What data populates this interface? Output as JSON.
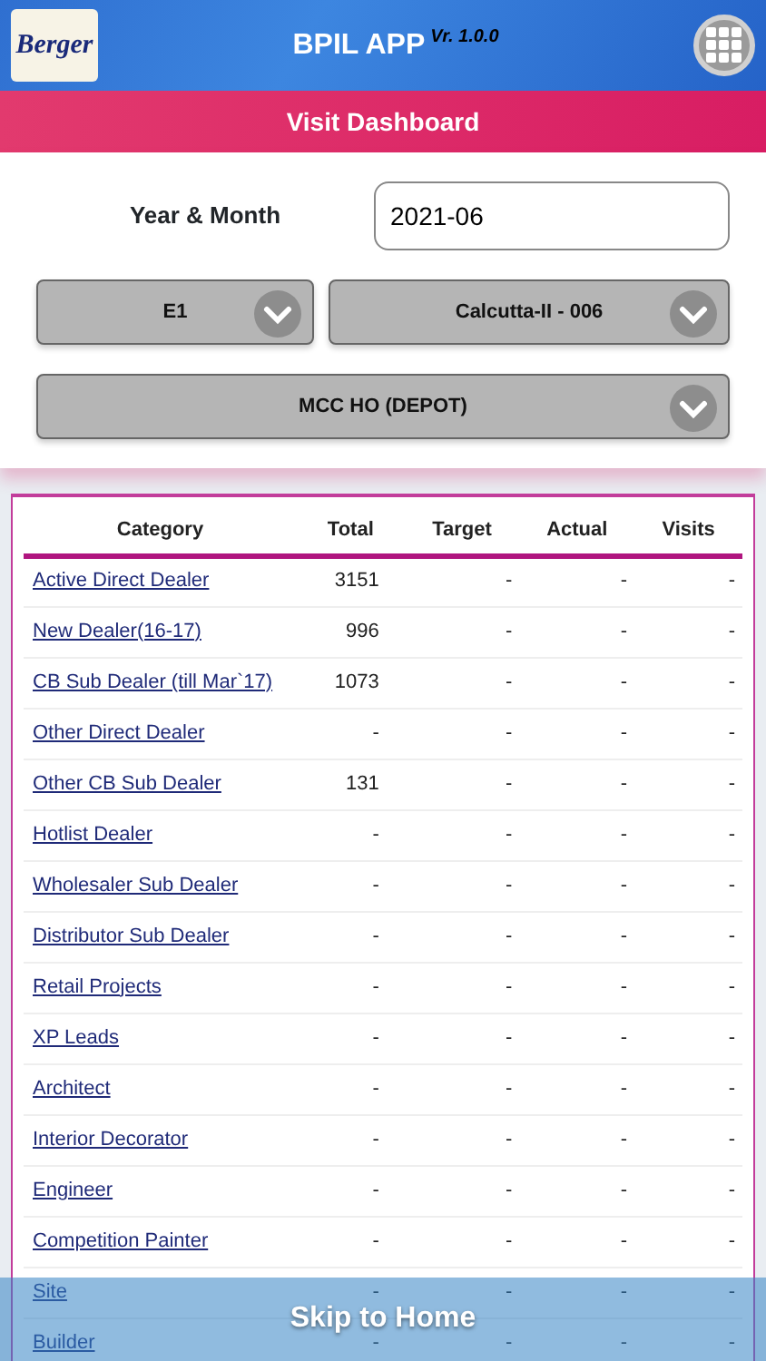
{
  "header": {
    "logo": "Berger",
    "title": "BPIL APP",
    "version": "Vr. 1.0.0"
  },
  "page_title": "Visit Dashboard",
  "filters": {
    "year_month_label": "Year & Month",
    "year_month_value": "2021-06",
    "dropdowns": [
      {
        "value": "E1"
      },
      {
        "value": "Calcutta-II - 006"
      },
      {
        "value": "MCC HO (DEPOT)"
      }
    ]
  },
  "table": {
    "columns": [
      "Category",
      "Total",
      "Target",
      "Actual",
      "Visits"
    ],
    "rows": [
      [
        "Active Direct Dealer",
        "3151",
        "-",
        "-",
        "-"
      ],
      [
        "New Dealer(16-17)",
        "996",
        "-",
        "-",
        "-"
      ],
      [
        "CB Sub Dealer (till Mar`17)",
        "1073",
        "-",
        "-",
        "-"
      ],
      [
        "Other Direct Dealer",
        "-",
        "-",
        "-",
        "-"
      ],
      [
        "Other CB Sub Dealer",
        "131",
        "-",
        "-",
        "-"
      ],
      [
        "Hotlist Dealer",
        "-",
        "-",
        "-",
        "-"
      ],
      [
        "Wholesaler Sub Dealer",
        "-",
        "-",
        "-",
        "-"
      ],
      [
        "Distributor Sub Dealer",
        "-",
        "-",
        "-",
        "-"
      ],
      [
        "Retail Projects",
        "-",
        "-",
        "-",
        "-"
      ],
      [
        "XP Leads",
        "-",
        "-",
        "-",
        "-"
      ],
      [
        "Architect",
        "-",
        "-",
        "-",
        "-"
      ],
      [
        "Interior Decorator",
        "-",
        "-",
        "-",
        "-"
      ],
      [
        "Engineer",
        "-",
        "-",
        "-",
        "-"
      ],
      [
        "Competition Painter",
        "-",
        "-",
        "-",
        "-"
      ],
      [
        "Site",
        "-",
        "-",
        "-",
        "-"
      ],
      [
        "Builder",
        "-",
        "-",
        "-",
        "-"
      ]
    ]
  },
  "footer_button": "Skip to Home"
}
